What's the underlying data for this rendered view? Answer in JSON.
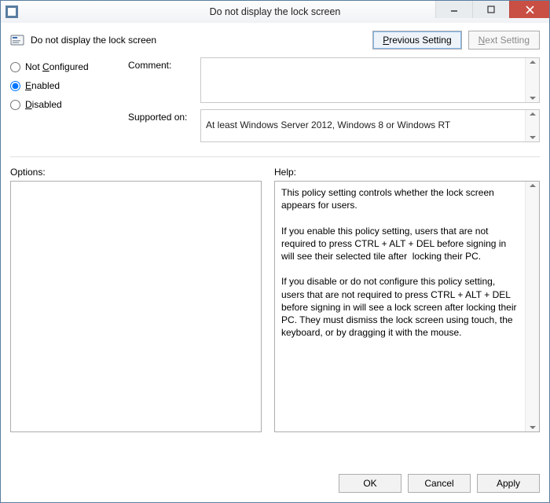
{
  "window": {
    "title": "Do not display the lock screen"
  },
  "header": {
    "policy_name": "Do not display the lock screen",
    "prev_button": "Previous Setting",
    "next_button": "Next Setting",
    "prev_underline": "P",
    "next_underline": "N"
  },
  "state_radios": {
    "not_configured": "Not ",
    "not_configured_ul": "C",
    "not_configured_rest": "onfigured",
    "enabled_ul": "E",
    "enabled_rest": "nabled",
    "disabled_ul": "D",
    "disabled_rest": "isabled",
    "selected": "enabled"
  },
  "fields": {
    "comment_label": "Comment:",
    "comment_value": "",
    "supported_label": "Supported on:",
    "supported_value": "At least Windows Server 2012, Windows 8 or Windows RT"
  },
  "panels": {
    "options_label": "Options:",
    "help_label": "Help:",
    "help_text": "This policy setting controls whether the lock screen appears for users.\n\nIf you enable this policy setting, users that are not required to press CTRL + ALT + DEL before signing in will see their selected tile after  locking their PC.\n\nIf you disable or do not configure this policy setting, users that are not required to press CTRL + ALT + DEL before signing in will see a lock screen after locking their PC. They must dismiss the lock screen using touch, the keyboard, or by dragging it with the mouse."
  },
  "buttons": {
    "ok": "OK",
    "cancel": "Cancel",
    "apply": "Apply"
  }
}
